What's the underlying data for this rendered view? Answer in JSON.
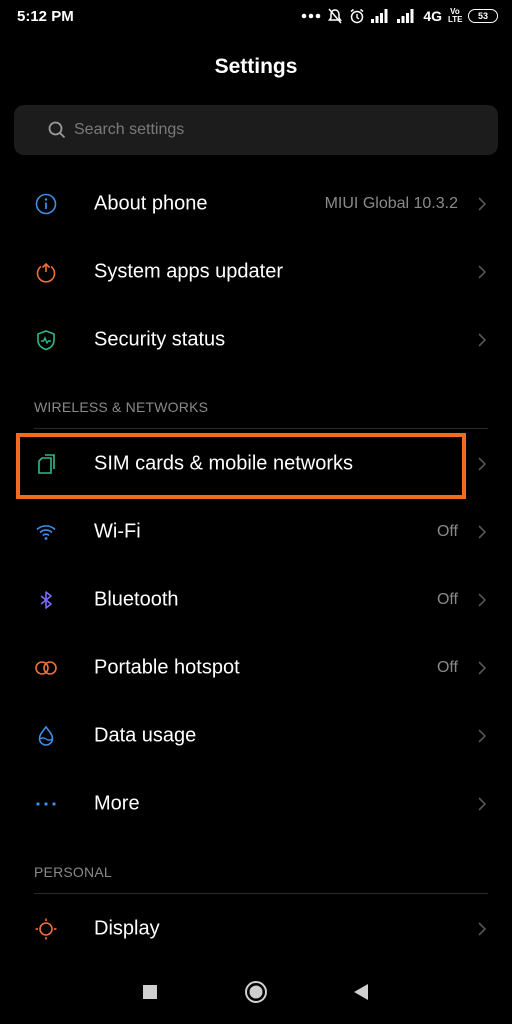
{
  "status_bar": {
    "time": "5:12 PM",
    "network": "4G",
    "volte_top": "Vo",
    "volte_bottom": "LTE",
    "battery": "53"
  },
  "header": {
    "title": "Settings"
  },
  "search": {
    "placeholder": "Search settings"
  },
  "items_top": [
    {
      "label": "About phone",
      "value": "MIUI Global 10.3.2",
      "icon": "info-icon",
      "color": "#3f8fe8"
    },
    {
      "label": "System apps updater",
      "value": "",
      "icon": "update-arrow-icon",
      "color": "#f0703a"
    },
    {
      "label": "Security status",
      "value": "",
      "icon": "shield-icon",
      "color": "#2fb88a"
    }
  ],
  "sections": {
    "wireless": "WIRELESS & NETWORKS",
    "personal": "PERSONAL"
  },
  "items_wireless": [
    {
      "label": "SIM cards & mobile networks",
      "value": "",
      "icon": "sim-card-icon",
      "color": "#2fb88a",
      "highlighted": true
    },
    {
      "label": "Wi-Fi",
      "value": "Off",
      "icon": "wifi-icon",
      "color": "#3f8fe8"
    },
    {
      "label": "Bluetooth",
      "value": "Off",
      "icon": "bluetooth-icon",
      "color": "#7b6cf0"
    },
    {
      "label": "Portable hotspot",
      "value": "Off",
      "icon": "hotspot-icon",
      "color": "#f0703a"
    },
    {
      "label": "Data usage",
      "value": "",
      "icon": "droplet-icon",
      "color": "#3f8fe8"
    },
    {
      "label": "More",
      "value": "",
      "icon": "more-dots-icon",
      "color": "#3f8fe8"
    }
  ],
  "items_personal": [
    {
      "label": "Display",
      "value": "",
      "icon": "sun-icon",
      "color": "#f0703a"
    }
  ],
  "colors": {
    "background": "#000000",
    "search_bg": "#1c1c1c",
    "highlight": "#f26b21",
    "secondary_text": "#8a8a8a"
  }
}
